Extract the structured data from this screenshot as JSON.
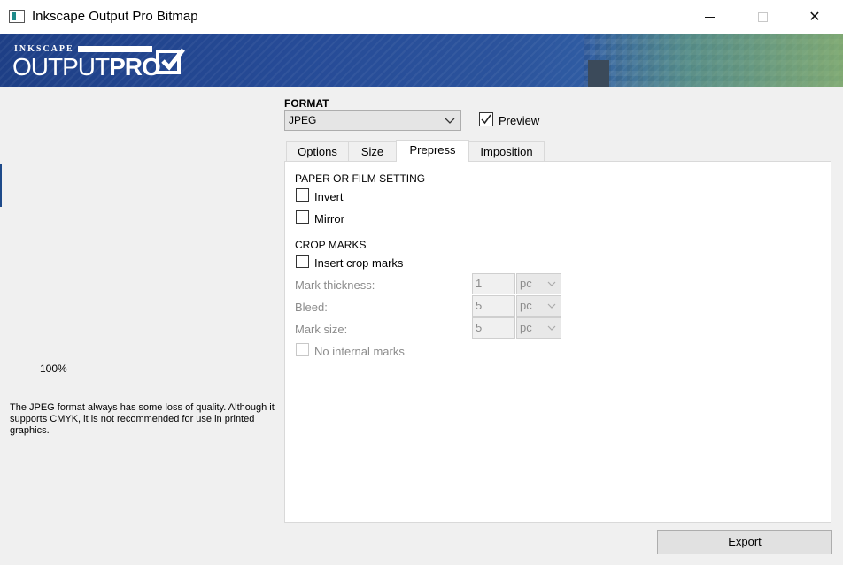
{
  "window": {
    "title": "Inkscape Output Pro Bitmap",
    "close_glyph": "✕"
  },
  "banner": {
    "logo_top": "INKSCAPE",
    "logo_main_light": "OUTPUT",
    "logo_main_bold": "PRO"
  },
  "left": {
    "zoom": "100%",
    "format_note": "The JPEG format always has some loss of quality. Although it supports CMYK, it is not recommended for use in printed graphics."
  },
  "format": {
    "label": "FORMAT",
    "selected": "JPEG",
    "preview_label": "Preview",
    "preview_checked": true
  },
  "tabs": [
    {
      "label": "Options",
      "active": false
    },
    {
      "label": "Size",
      "active": false
    },
    {
      "label": "Prepress",
      "active": true
    },
    {
      "label": "Imposition",
      "active": false
    }
  ],
  "prepress": {
    "paper_section": "PAPER OR FILM SETTING",
    "invert_label": "Invert",
    "mirror_label": "Mirror",
    "crop_section": "CROP MARKS",
    "insert_crop_label": "Insert crop marks",
    "mark_thickness_label": "Mark thickness:",
    "mark_thickness_value": "1",
    "mark_thickness_unit": "pc",
    "bleed_label": "Bleed:",
    "bleed_value": "5",
    "bleed_unit": "pc",
    "mark_size_label": "Mark size:",
    "mark_size_value": "5",
    "mark_size_unit": "pc",
    "no_internal_label": "No internal marks"
  },
  "footer": {
    "export_label": "Export"
  }
}
